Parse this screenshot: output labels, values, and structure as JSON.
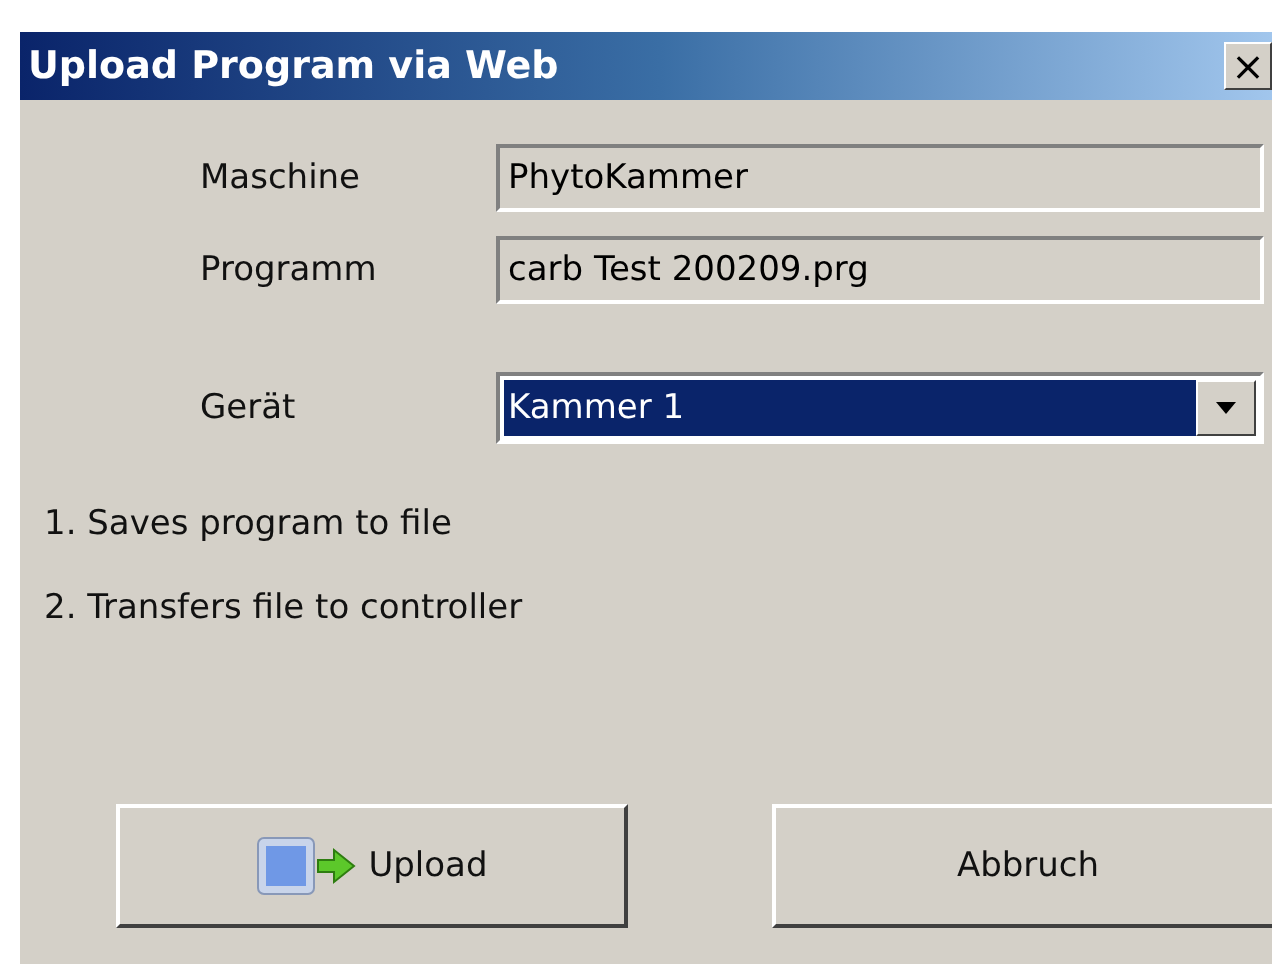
{
  "window": {
    "title": "Upload Program via Web",
    "close": "×"
  },
  "fields": [
    {
      "label": "Maschine",
      "value": "PhytoKammer"
    },
    {
      "label": "Programm",
      "value": "carb Test 200209.prg"
    }
  ],
  "device": {
    "label": "Gerät",
    "value": "Kammer 1",
    "selected": true
  },
  "steps": [
    "1. Saves program to file",
    "2. Transfers file to controller"
  ],
  "buttons": [
    {
      "kind": "upload",
      "label": "Upload"
    },
    {
      "kind": "plain",
      "label": "Abbruch"
    }
  ]
}
